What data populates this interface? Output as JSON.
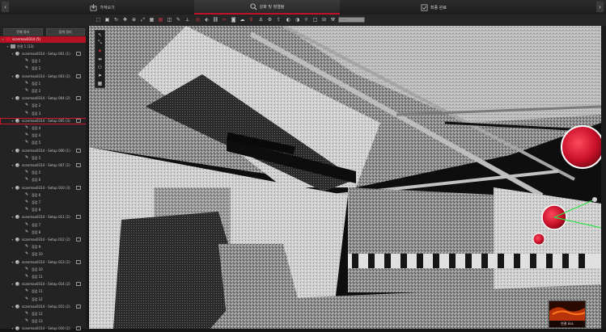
{
  "nav": {
    "tabs": [
      {
        "label": "가져오기",
        "icon": "import-icon"
      },
      {
        "label": "강화 및 정렬됨",
        "icon": "register-icon"
      },
      {
        "label": "최종 완료",
        "icon": "finalize-icon"
      }
    ]
  },
  "toolbar": {
    "input_value": "······"
  },
  "panel": {
    "tabs": [
      "전체 정리",
      "탐색 정리"
    ],
    "root": "scanmax0314 (5)",
    "group": "연결 1 (13)",
    "items": [
      {
        "label": "scanmax0314 - Setup 001 (1)",
        "sub": [
          "점검 1",
          "점검 2"
        ]
      },
      {
        "label": "scanmax0314 - Setup 003 (2)",
        "sub": [
          "점검 1",
          "점검 2"
        ]
      },
      {
        "label": "scanmax0314 - Setup 004 (2)",
        "sub": [
          "점검 2",
          "점검 3"
        ]
      },
      {
        "label": "scanmax0314 - Setup 005 (3)",
        "sub": [
          "점검 4",
          "점검 4",
          "점검 5"
        ]
      },
      {
        "label": "scanmax0314 - Setup 006 (1)",
        "sub": [
          "점검 5"
        ]
      },
      {
        "label": "scanmax0314 - Setup 007 (2)",
        "sub": [
          "점검 5",
          "점검 6"
        ]
      },
      {
        "label": "scanmax0314 - Setup 010 (3)",
        "sub": [
          "점검 6",
          "점검 7",
          "점검 8"
        ]
      },
      {
        "label": "scanmax0314 - Setup 011 (2)",
        "sub": [
          "점검 7",
          "점검 8"
        ]
      },
      {
        "label": "scanmax0314 - Setup 012 (2)",
        "sub": [
          "점검 9",
          "점검 10"
        ]
      },
      {
        "label": "scanmax0314 - Setup 013 (2)",
        "sub": [
          "점검 10",
          "점검 11"
        ]
      },
      {
        "label": "scanmax0314 - Setup 014 (2)",
        "sub": [
          "점검 11",
          "점검 12"
        ]
      },
      {
        "label": "scanmax0314 - Setup 015 (2)",
        "sub": [
          "점검 12",
          "점검 13"
        ]
      },
      {
        "label": "scanmax0314 - Setup 016 (2)",
        "sub": []
      }
    ]
  },
  "viewport": {
    "thumb_label": "연결 요소"
  },
  "colors": {
    "accent": "#d4162b",
    "panel": "#232323",
    "toolbar": "#262626"
  }
}
